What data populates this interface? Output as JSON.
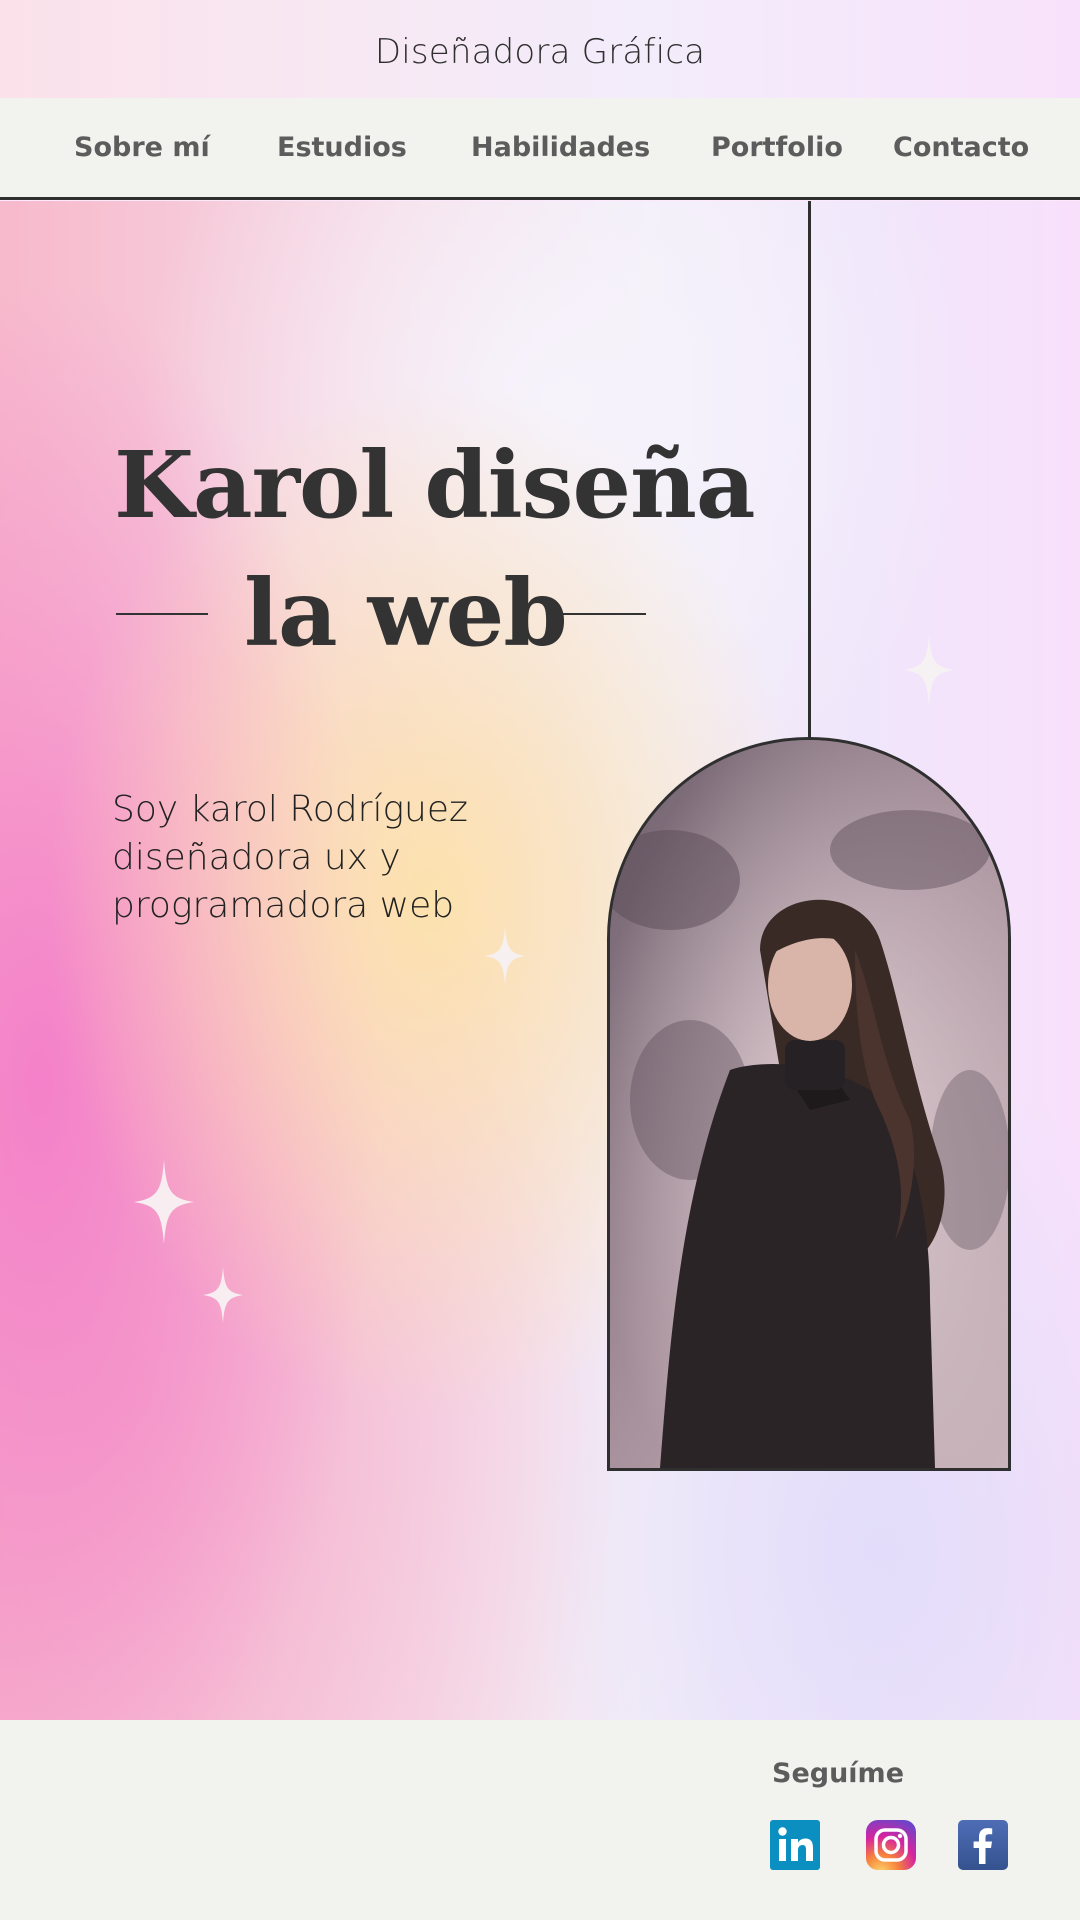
{
  "header": {
    "title": "Diseñadora Gráfica"
  },
  "nav": {
    "items": [
      {
        "label": "Sobre mí"
      },
      {
        "label": "Estudios"
      },
      {
        "label": "Habilidades"
      },
      {
        "label": "Portfolio"
      },
      {
        "label": "Contacto"
      }
    ]
  },
  "hero": {
    "headline_line1": "Karol diseña",
    "headline_line2": "la web",
    "intro": "Soy karol Rodríguez diseñadora ux y programadora web"
  },
  "footer": {
    "follow_label": "Seguíme",
    "social": [
      {
        "name": "linkedin",
        "glyph": "in",
        "color": "#0a66c2"
      },
      {
        "name": "instagram",
        "color": "#d6249f"
      },
      {
        "name": "facebook",
        "glyph": "f",
        "color": "#3b5998"
      }
    ]
  },
  "colors": {
    "text": "#333333",
    "nav_text": "#5c5c5c",
    "nav_background": "#f2f2ef",
    "accent_pink": "#f478c8",
    "accent_peach": "#fde2aa"
  }
}
